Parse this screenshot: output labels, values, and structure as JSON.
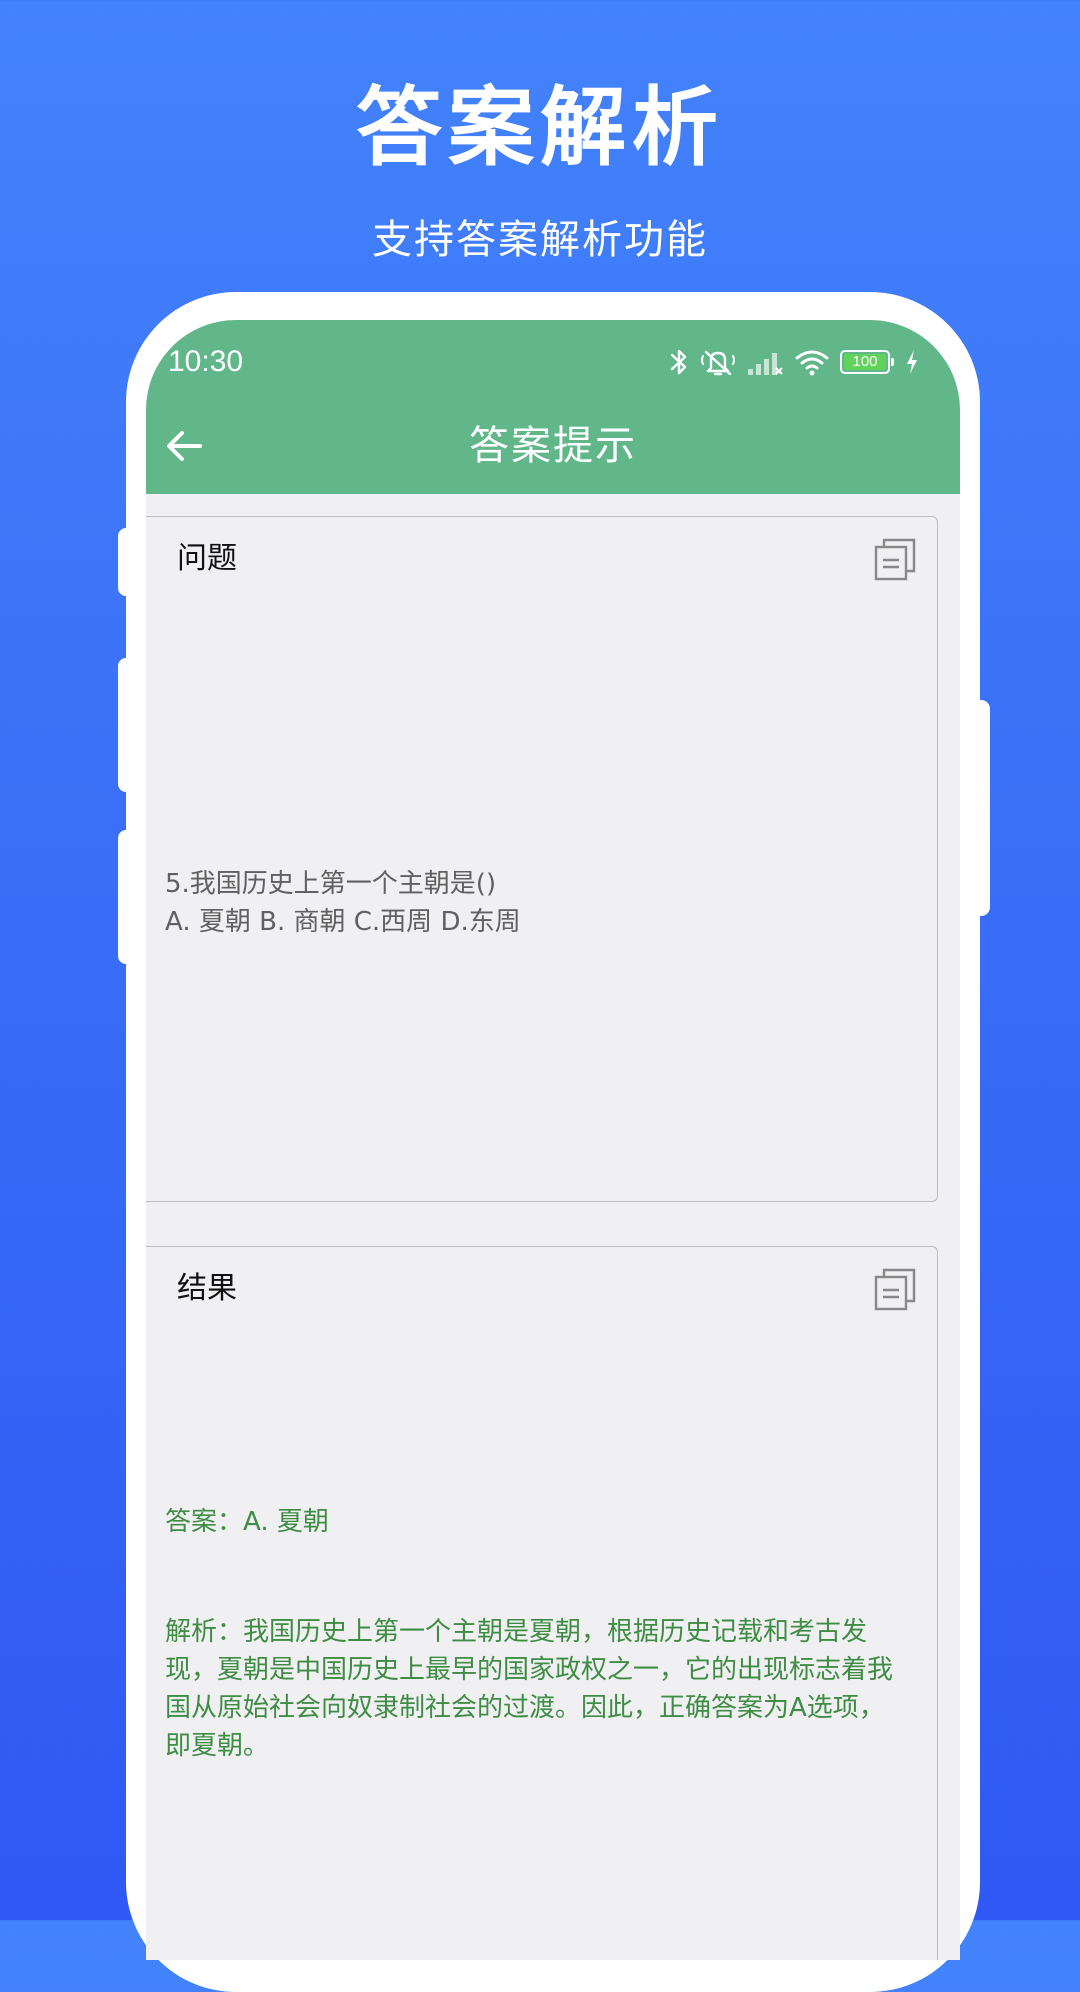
{
  "promo": {
    "title": "答案解析",
    "subtitle": "支持答案解析功能"
  },
  "status_bar": {
    "time": "10:30",
    "battery": "100",
    "icons": [
      "bluetooth-icon",
      "mute-icon",
      "signal-icon",
      "wifi-icon",
      "battery-icon",
      "charging-icon"
    ]
  },
  "nav": {
    "title": "答案提示",
    "back_icon": "arrow-left-icon"
  },
  "question_card": {
    "title": "问题",
    "text": "5.我国历史上第一个主朝是()\nA. 夏朝 B. 商朝 C.西周 D.东周",
    "copy_icon": "copy-icon"
  },
  "result_card": {
    "title": "结果",
    "answer": "答案：A. 夏朝",
    "analysis": "解析：我国历史上第一个主朝是夏朝，根据历史记载和考古发现，夏朝是中国历史上最早的国家政权之一，它的出现标志着我国从原始社会向奴隶制社会的过渡。因此，正确答案为A选项，即夏朝。",
    "copy_icon": "copy-icon"
  },
  "colors": {
    "background_top": "#4383fb",
    "background_bottom": "#2f58f4",
    "app_bar": "#62b78a",
    "answer_text": "#3f8c45",
    "question_text": "#606060"
  }
}
